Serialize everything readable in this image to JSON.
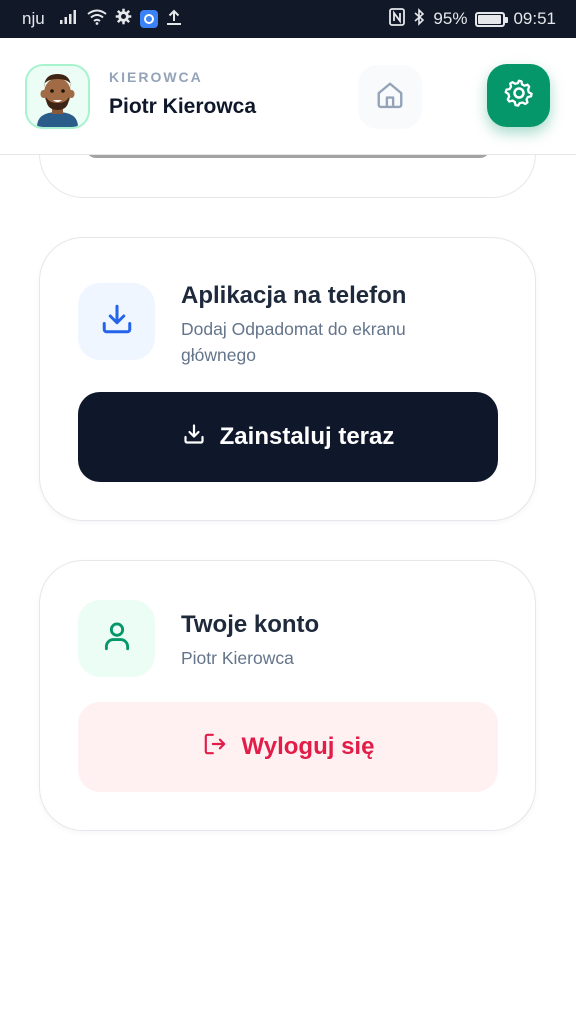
{
  "status_bar": {
    "carrier": "nju",
    "battery": "95%",
    "battery_level": 0.95,
    "time": "09:51"
  },
  "header": {
    "role": "KIEROWCA",
    "name": "Piotr Kierowca",
    "icons": [
      "avatar",
      "home-icon",
      "settings-gear-icon"
    ]
  },
  "app_card": {
    "title": "Aplikacja na telefon",
    "subtitle": "Dodaj Odpadomat do ekranu głównego",
    "button_label": "Zainstaluj teraz",
    "icon": "download-icon"
  },
  "account_card": {
    "title": "Twoje konto",
    "subtitle": "Piotr Kierowca",
    "logout_label": "Wyloguj się",
    "icon": "user-icon"
  },
  "colors": {
    "primary_dark": "#0f172a",
    "accent_green": "#059669",
    "danger": "#e11d48",
    "danger_bg": "#fff1f2",
    "info_bg": "#eff6ff",
    "success_bg": "#ecfdf5"
  }
}
